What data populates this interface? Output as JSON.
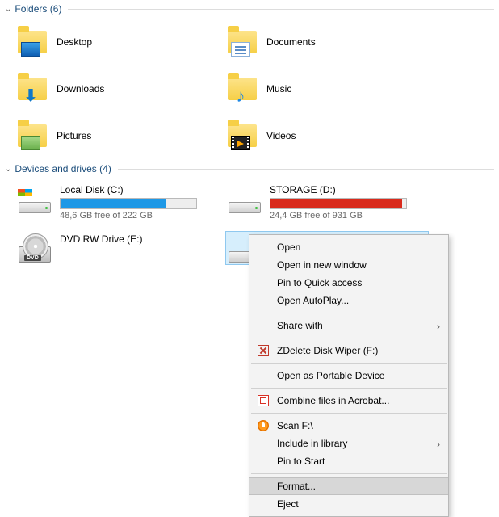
{
  "sections": {
    "folders": {
      "title": "Folders",
      "count": 6
    },
    "drives": {
      "title": "Devices and drives",
      "count": 4
    }
  },
  "folders": [
    {
      "label": "Desktop"
    },
    {
      "label": "Documents"
    },
    {
      "label": "Downloads"
    },
    {
      "label": "Music"
    },
    {
      "label": "Pictures"
    },
    {
      "label": "Videos"
    }
  ],
  "drives": {
    "c": {
      "name": "Local Disk (C:)",
      "free_text": "48,6 GB free of 222 GB",
      "used_pct": 78,
      "bar_color": "#1e98e6"
    },
    "d": {
      "name": "STORAGE (D:)",
      "free_text": "24,4 GB free of 931 GB",
      "used_pct": 97,
      "bar_color": "#d92a1c"
    },
    "e": {
      "name": "DVD RW Drive (E:)"
    }
  },
  "context_menu": {
    "open": "Open",
    "open_new_window": "Open in new window",
    "pin_quick_access": "Pin to Quick access",
    "open_autoplay": "Open AutoPlay...",
    "share_with": "Share with",
    "zdelete": "ZDelete Disk Wiper (F:)",
    "portable": "Open as Portable Device",
    "acrobat": "Combine files in Acrobat...",
    "scan": "Scan F:\\",
    "include_library": "Include in library",
    "pin_start": "Pin to Start",
    "format": "Format...",
    "eject": "Eject"
  }
}
